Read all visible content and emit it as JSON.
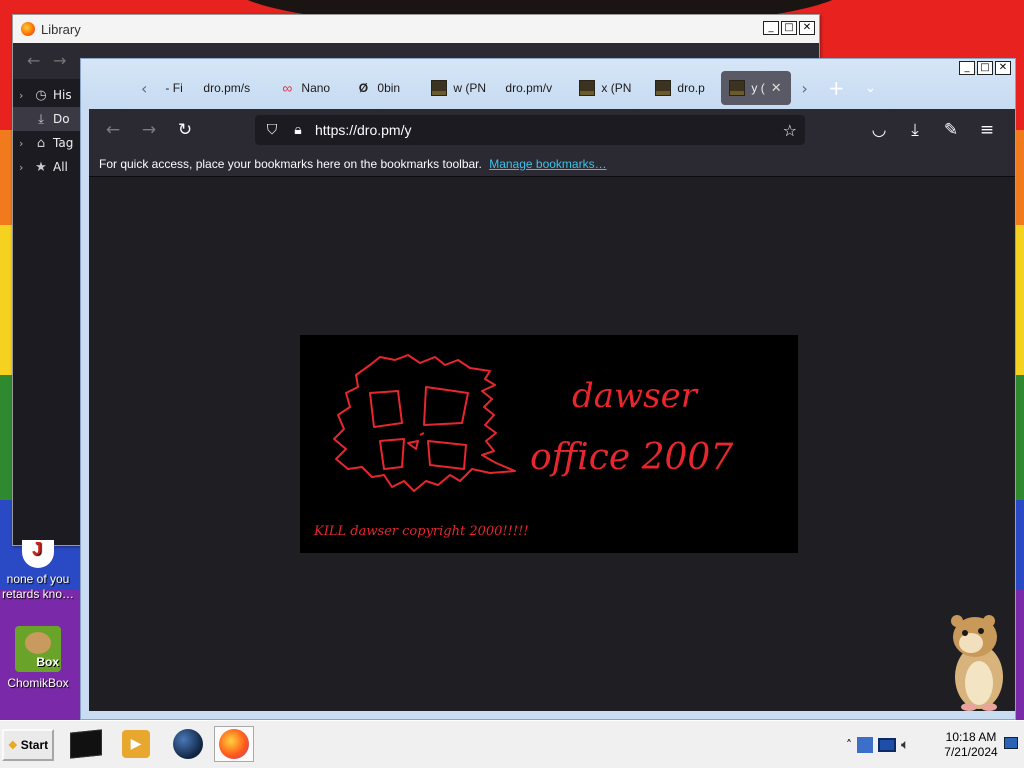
{
  "library": {
    "title": "Library",
    "sidebar": [
      {
        "label": "His",
        "icon": "clock-icon"
      },
      {
        "label": "Do",
        "icon": "download-icon",
        "selected": true
      },
      {
        "label": "Tag",
        "icon": "tag-icon"
      },
      {
        "label": "All",
        "icon": "star-icon"
      }
    ]
  },
  "firefox": {
    "tabs": [
      {
        "label": "- Fi",
        "favicon": "none"
      },
      {
        "label": "dro.pm/s",
        "favicon": "none"
      },
      {
        "label": "Nano",
        "favicon": "nano-icon"
      },
      {
        "label": "0bin",
        "favicon": "0bin-icon"
      },
      {
        "label": "w (PN",
        "favicon": "image-thumb-icon"
      },
      {
        "label": "dro.pm/v",
        "favicon": "none"
      },
      {
        "label": "x (PN",
        "favicon": "image-thumb-icon"
      },
      {
        "label": "dro.p",
        "favicon": "image-thumb-icon"
      },
      {
        "label": "y (",
        "favicon": "image-thumb-icon",
        "active": true
      }
    ],
    "url": "https://dro.pm/y",
    "bookmarks_bar": {
      "message": "For quick access, place your bookmarks here on the bookmarks toolbar.",
      "link": "Manage bookmarks…"
    }
  },
  "artwork": {
    "line1": "dawser",
    "line2": "office 2007",
    "footer": "KILL dawser copyright 2000!!!!!",
    "ink_color": "#e8262e"
  },
  "desktop": {
    "icon1_label": "none of you retards kno…",
    "icon2_label": "ChomikBox",
    "icon2_badge": "Box"
  },
  "taskbar": {
    "start_label": "Start",
    "time": "10:18 AM",
    "date": "7/21/2024"
  }
}
